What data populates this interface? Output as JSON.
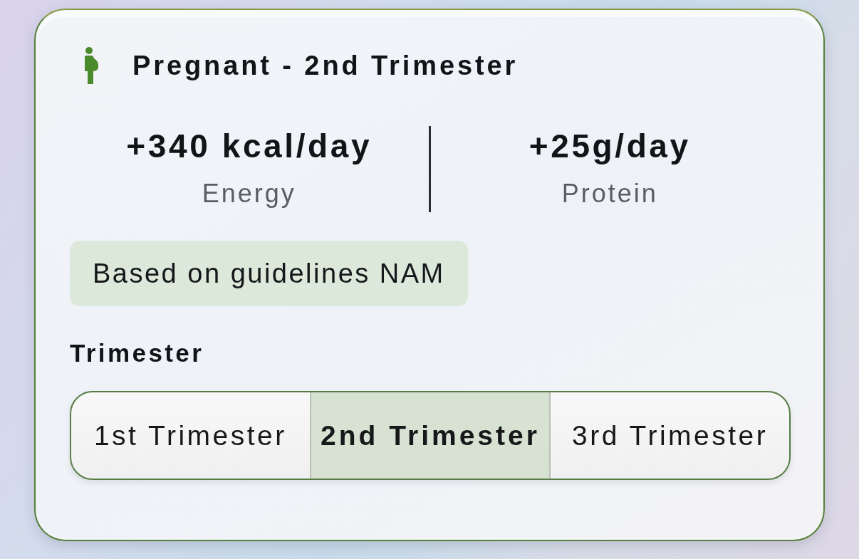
{
  "header": {
    "title": "Pregnant - 2nd Trimester"
  },
  "stats": [
    {
      "value": "+340 kcal/day",
      "label": "Energy"
    },
    {
      "value": "+25g/day",
      "label": "Protein"
    }
  ],
  "note": "Based on guidelines NAM",
  "trimester": {
    "label": "Trimester",
    "options": [
      {
        "label": "1st Trimester",
        "selected": false
      },
      {
        "label": "2nd Trimester",
        "selected": true
      },
      {
        "label": "3rd Trimester",
        "selected": false
      }
    ]
  }
}
